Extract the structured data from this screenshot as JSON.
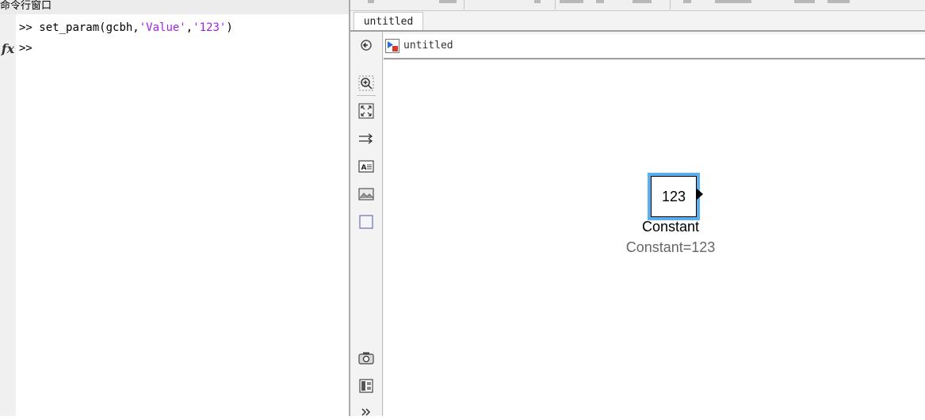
{
  "command_window": {
    "title": "命令行窗口",
    "fx_icon": "fx",
    "lines": [
      {
        "prompt": ">>",
        "code_prefix": "set_param(gcbh,",
        "str1": "'Value'",
        "sep": ",",
        "str2": "'123'",
        "code_suffix": ")"
      },
      {
        "prompt": ">>"
      }
    ],
    "string_color": "#a020f0"
  },
  "editor": {
    "tab_label": "untitled",
    "breadcrumb": {
      "icon": "simulink-model-icon",
      "label": "untitled"
    },
    "palette_icons": [
      "hide-browser-icon",
      "zoom-in-icon",
      "fit-to-view-icon",
      "signal-route-icon",
      "annotation-icon",
      "image-icon",
      "area-icon",
      "screenshot-icon",
      "model-browser-icon",
      "more-chevron-icon"
    ],
    "selection_color": "#5ab0ee"
  },
  "block": {
    "value": "123",
    "name": "Constant",
    "annotation": "Constant=123"
  }
}
